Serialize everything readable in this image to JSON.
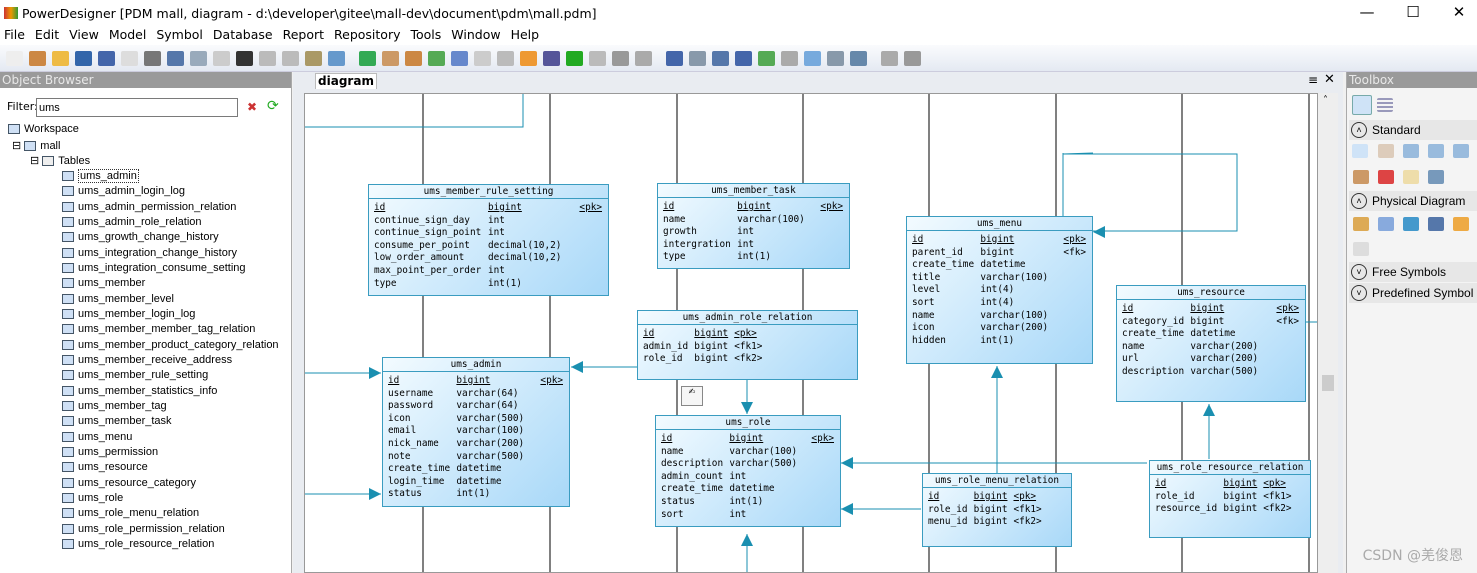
{
  "window": {
    "title": "PowerDesigner [PDM mall, diagram - d:\\developer\\gitee\\mall-dev\\document\\pdm\\mall.pdm]",
    "minimize": "—",
    "maximize": "☐",
    "close": "✕"
  },
  "menu": [
    "File",
    "Edit",
    "View",
    "Model",
    "Symbol",
    "Database",
    "Report",
    "Repository",
    "Tools",
    "Window",
    "Help"
  ],
  "object_browser": {
    "title": "Object Browser",
    "filter_label": "Filter:",
    "filter_value": "ums",
    "workspace": "Workspace",
    "model": "mall",
    "folder": "Tables",
    "tables": [
      "ums_admin",
      "ums_admin_login_log",
      "ums_admin_permission_relation",
      "ums_admin_role_relation",
      "ums_growth_change_history",
      "ums_integration_change_history",
      "ums_integration_consume_setting",
      "ums_member",
      "ums_member_level",
      "ums_member_login_log",
      "ums_member_member_tag_relation",
      "ums_member_product_category_relation",
      "ums_member_receive_address",
      "ums_member_rule_setting",
      "ums_member_statistics_info",
      "ums_member_tag",
      "ums_member_task",
      "ums_menu",
      "ums_permission",
      "ums_resource",
      "ums_resource_category",
      "ums_role",
      "ums_role_menu_relation",
      "ums_role_permission_relation",
      "ums_role_resource_relation"
    ],
    "selected": "ums_admin"
  },
  "diagram": {
    "tab": "diagram",
    "entities": [
      {
        "name": "ums_member_rule_setting",
        "cols": [
          [
            "id",
            "bigint",
            "<pk>"
          ],
          [
            "continue_sign_day",
            "int",
            ""
          ],
          [
            "continue_sign_point",
            "int",
            ""
          ],
          [
            "consume_per_point",
            "decimal(10,2)",
            ""
          ],
          [
            "low_order_amount",
            "decimal(10,2)",
            ""
          ],
          [
            "max_point_per_order",
            "int",
            ""
          ],
          [
            "type",
            "int(1)",
            ""
          ]
        ]
      },
      {
        "name": "ums_member_task",
        "cols": [
          [
            "id",
            "bigint",
            "<pk>"
          ],
          [
            "name",
            "varchar(100)",
            ""
          ],
          [
            "growth",
            "int",
            ""
          ],
          [
            "intergration",
            "int",
            ""
          ],
          [
            "type",
            "int(1)",
            ""
          ]
        ]
      },
      {
        "name": "ums_admin_role_relation",
        "cols": [
          [
            "id",
            "bigint",
            "<pk>"
          ],
          [
            "admin_id",
            "bigint",
            "<fk1>"
          ],
          [
            "role_id",
            "bigint",
            "<fk2>"
          ]
        ]
      },
      {
        "name": "ums_admin",
        "cols": [
          [
            "id",
            "bigint",
            "<pk>"
          ],
          [
            "username",
            "varchar(64)",
            ""
          ],
          [
            "password",
            "varchar(64)",
            ""
          ],
          [
            "icon",
            "varchar(500)",
            ""
          ],
          [
            "email",
            "varchar(100)",
            ""
          ],
          [
            "nick_name",
            "varchar(200)",
            ""
          ],
          [
            "note",
            "varchar(500)",
            ""
          ],
          [
            "create_time",
            "datetime",
            ""
          ],
          [
            "login_time",
            "datetime",
            ""
          ],
          [
            "status",
            "int(1)",
            ""
          ]
        ]
      },
      {
        "name": "ums_role",
        "cols": [
          [
            "id",
            "bigint",
            "<pk>"
          ],
          [
            "name",
            "varchar(100)",
            ""
          ],
          [
            "description",
            "varchar(500)",
            ""
          ],
          [
            "admin_count",
            "int",
            ""
          ],
          [
            "create_time",
            "datetime",
            ""
          ],
          [
            "status",
            "int(1)",
            ""
          ],
          [
            "sort",
            "int",
            ""
          ]
        ]
      },
      {
        "name": "ums_menu",
        "cols": [
          [
            "id",
            "bigint",
            "<pk>"
          ],
          [
            "parent_id",
            "bigint",
            "<fk>"
          ],
          [
            "create_time",
            "datetime",
            ""
          ],
          [
            "title",
            "varchar(100)",
            ""
          ],
          [
            "level",
            "int(4)",
            ""
          ],
          [
            "sort",
            "int(4)",
            ""
          ],
          [
            "name",
            "varchar(100)",
            ""
          ],
          [
            "icon",
            "varchar(200)",
            ""
          ],
          [
            "hidden",
            "int(1)",
            ""
          ]
        ]
      },
      {
        "name": "ums_resource",
        "cols": [
          [
            "id",
            "bigint",
            "<pk>"
          ],
          [
            "category_id",
            "bigint",
            "<fk>"
          ],
          [
            "create_time",
            "datetime",
            ""
          ],
          [
            "name",
            "varchar(200)",
            ""
          ],
          [
            "url",
            "varchar(200)",
            ""
          ],
          [
            "description",
            "varchar(500)",
            ""
          ]
        ]
      },
      {
        "name": "ums_role_menu_relation",
        "cols": [
          [
            "id",
            "bigint",
            "<pk>"
          ],
          [
            "role_id",
            "bigint",
            "<fk1>"
          ],
          [
            "menu_id",
            "bigint",
            "<fk2>"
          ]
        ]
      },
      {
        "name": "ums_role_resource_relation",
        "cols": [
          [
            "id",
            "bigint",
            "<pk>"
          ],
          [
            "role_id",
            "bigint",
            "<fk1>"
          ],
          [
            "resource_id",
            "bigint",
            "<fk2>"
          ]
        ]
      }
    ]
  },
  "toolbox": {
    "title": "Toolbox",
    "sections": [
      "Standard",
      "Physical Diagram",
      "Free Symbols",
      "Predefined Symbol"
    ]
  },
  "watermark": "CSDN @羌俊恩"
}
